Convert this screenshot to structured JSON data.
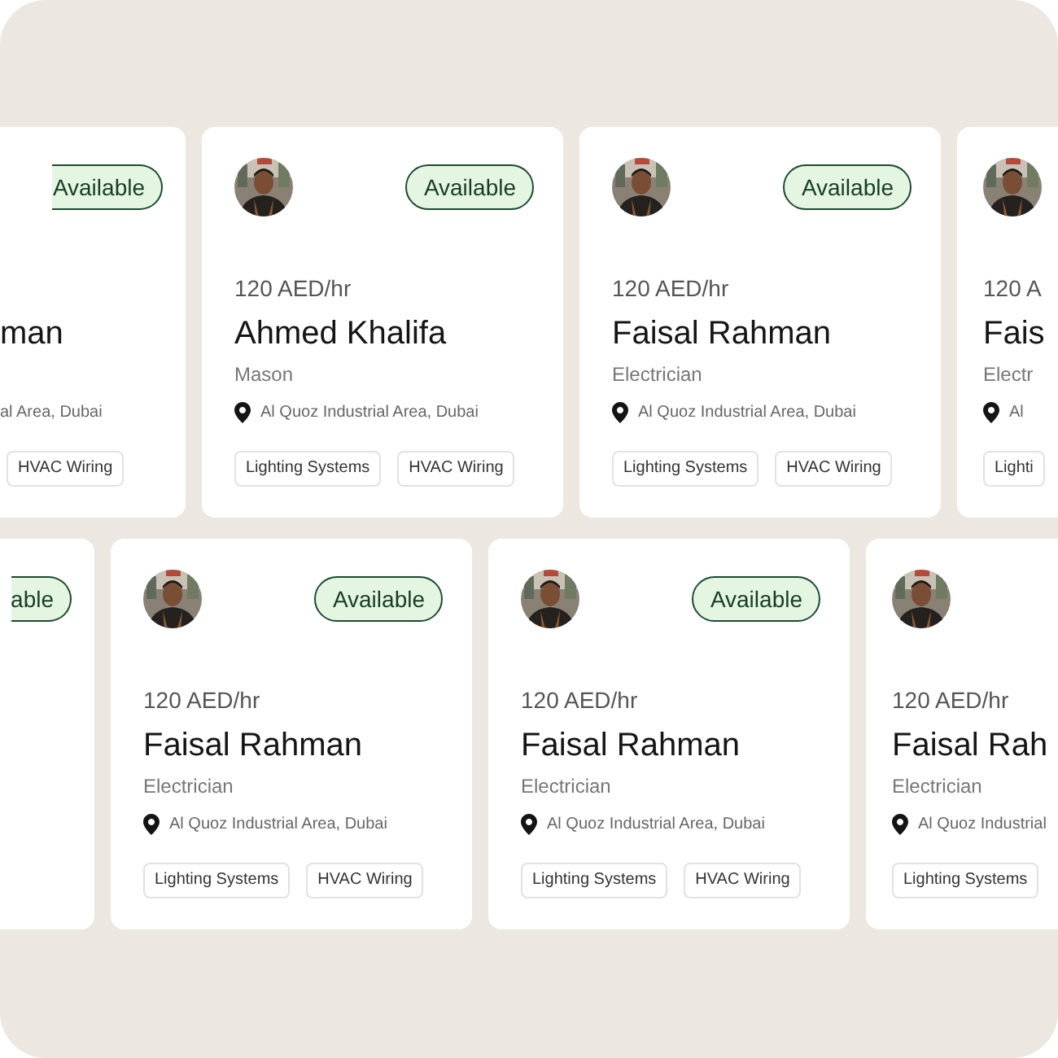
{
  "rows": [
    {
      "cards": [
        {
          "kind": "cut-left",
          "status": "Available",
          "name": "man",
          "location": "al Area, Dubai",
          "tags": [
            "HVAC Wiring"
          ]
        },
        {
          "kind": "full",
          "status": "Available",
          "price": "120 AED/hr",
          "name": "Ahmed Khalifa",
          "role": "Mason",
          "location": "Al Quoz Industrial Area, Dubai",
          "tags": [
            "Lighting Systems",
            "HVAC Wiring"
          ]
        },
        {
          "kind": "full",
          "status": "Available",
          "price": "120 AED/hr",
          "name": "Faisal Rahman",
          "role": "Electrician",
          "location": "Al Quoz Industrial Area, Dubai",
          "tags": [
            "Lighting Systems",
            "HVAC Wiring"
          ]
        },
        {
          "kind": "cut-right",
          "price": "120 A",
          "name": "Fais",
          "role": "Electr",
          "location": "Al",
          "tags": [
            "Lighti"
          ]
        }
      ]
    },
    {
      "cards": [
        {
          "kind": "cut-left",
          "status": "able"
        },
        {
          "kind": "full",
          "status": "Available",
          "price": "120 AED/hr",
          "name": "Faisal Rahman",
          "role": "Electrician",
          "location": "Al Quoz Industrial Area, Dubai",
          "tags": [
            "Lighting Systems",
            "HVAC Wiring"
          ]
        },
        {
          "kind": "full",
          "status": "Available",
          "price": "120 AED/hr",
          "name": "Faisal Rahman",
          "role": "Electrician",
          "location": "Al Quoz Industrial Area, Dubai",
          "tags": [
            "Lighting Systems",
            "HVAC Wiring"
          ]
        },
        {
          "kind": "cut-right",
          "price": "120 AED/hr",
          "name": "Faisal Rah",
          "role": "Electrician",
          "location": "Al Quoz Industrial",
          "tags": [
            "Lighting Systems"
          ]
        }
      ]
    }
  ]
}
